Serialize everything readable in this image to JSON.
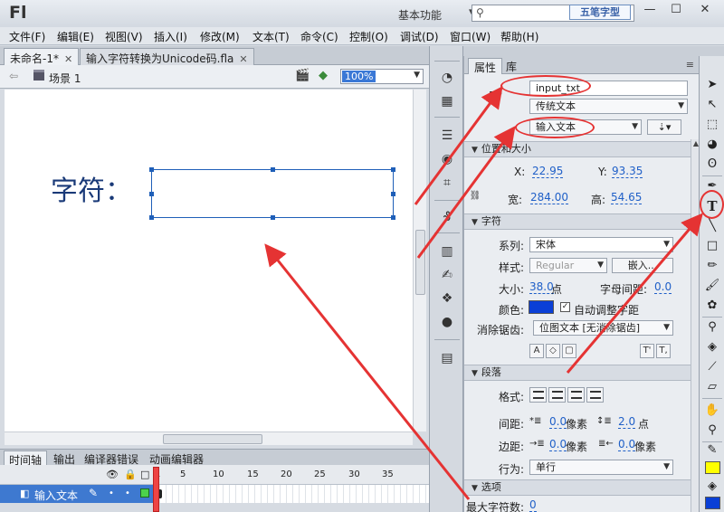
{
  "app": {
    "logo": "Fl",
    "workspace": "基本功能",
    "watermark": "五笔字型"
  },
  "menu": [
    "文件(F)",
    "编辑(E)",
    "视图(V)",
    "插入(I)",
    "修改(M)",
    "文本(T)",
    "命令(C)",
    "控制(O)",
    "调试(D)",
    "窗口(W)",
    "帮助(H)"
  ],
  "doc_tabs": [
    {
      "label": "未命名-1*",
      "active": true
    },
    {
      "label": "输入字符转换为Unicode码.fla",
      "active": false
    }
  ],
  "edit_bar": {
    "scene": "场景 1",
    "zoom": "100%"
  },
  "stage": {
    "label": "字符："
  },
  "timeline": {
    "tabs": [
      "时间轴",
      "输出",
      "编译器错误",
      "动画编辑器"
    ],
    "frame_numbers": [
      "1",
      "5",
      "10",
      "15",
      "20",
      "25",
      "30",
      "35"
    ],
    "layer_name": "输入文本"
  },
  "props": {
    "tabs": [
      "属性",
      "库"
    ],
    "instance_name": "input_txt",
    "text_engine": "传统文本",
    "text_type": "输入文本",
    "position_section": "位置和大小",
    "x_label": "X:",
    "x_value": "22.95",
    "y_label": "Y:",
    "y_value": "93.35",
    "width_label": "宽:",
    "width_value": "284.00",
    "height_label": "高:",
    "height_value": "54.65",
    "char_section": "字符",
    "family_label": "系列:",
    "family_value": "宋体",
    "style_label": "样式:",
    "style_value": "Regular",
    "embed_label": "嵌入...",
    "size_label": "大小:",
    "size_value": "38.0",
    "size_unit": "点",
    "spacing_label": "字母间距:",
    "spacing_value": "0.0",
    "color_label": "颜色:",
    "color": "#0a3fd6",
    "auto_kern": "自动调整字距",
    "aa_label": "消除锯齿:",
    "aa_value": "位图文本 [无消除锯齿]",
    "para_section": "段落",
    "format_label": "格式:",
    "gap_label": "间距:",
    "indent_value": "0.0",
    "indent_unit": "像素",
    "line_spacing_value": "2.0",
    "line_spacing_unit": "点",
    "margin_label": "边距:",
    "left_margin_value": "0.0",
    "left_margin_unit": "像素",
    "right_margin_value": "0.0",
    "right_margin_unit": "像素",
    "behavior_label": "行为:",
    "behavior_value": "单行",
    "options_section": "选项",
    "maxchars_label": "最大字符数:",
    "maxchars_value": "0"
  },
  "colors": {
    "accent": "#3a78d6",
    "annotation": "#e53333",
    "fill_color": "#ffff00",
    "stroke_color": "#0a3fd6"
  }
}
